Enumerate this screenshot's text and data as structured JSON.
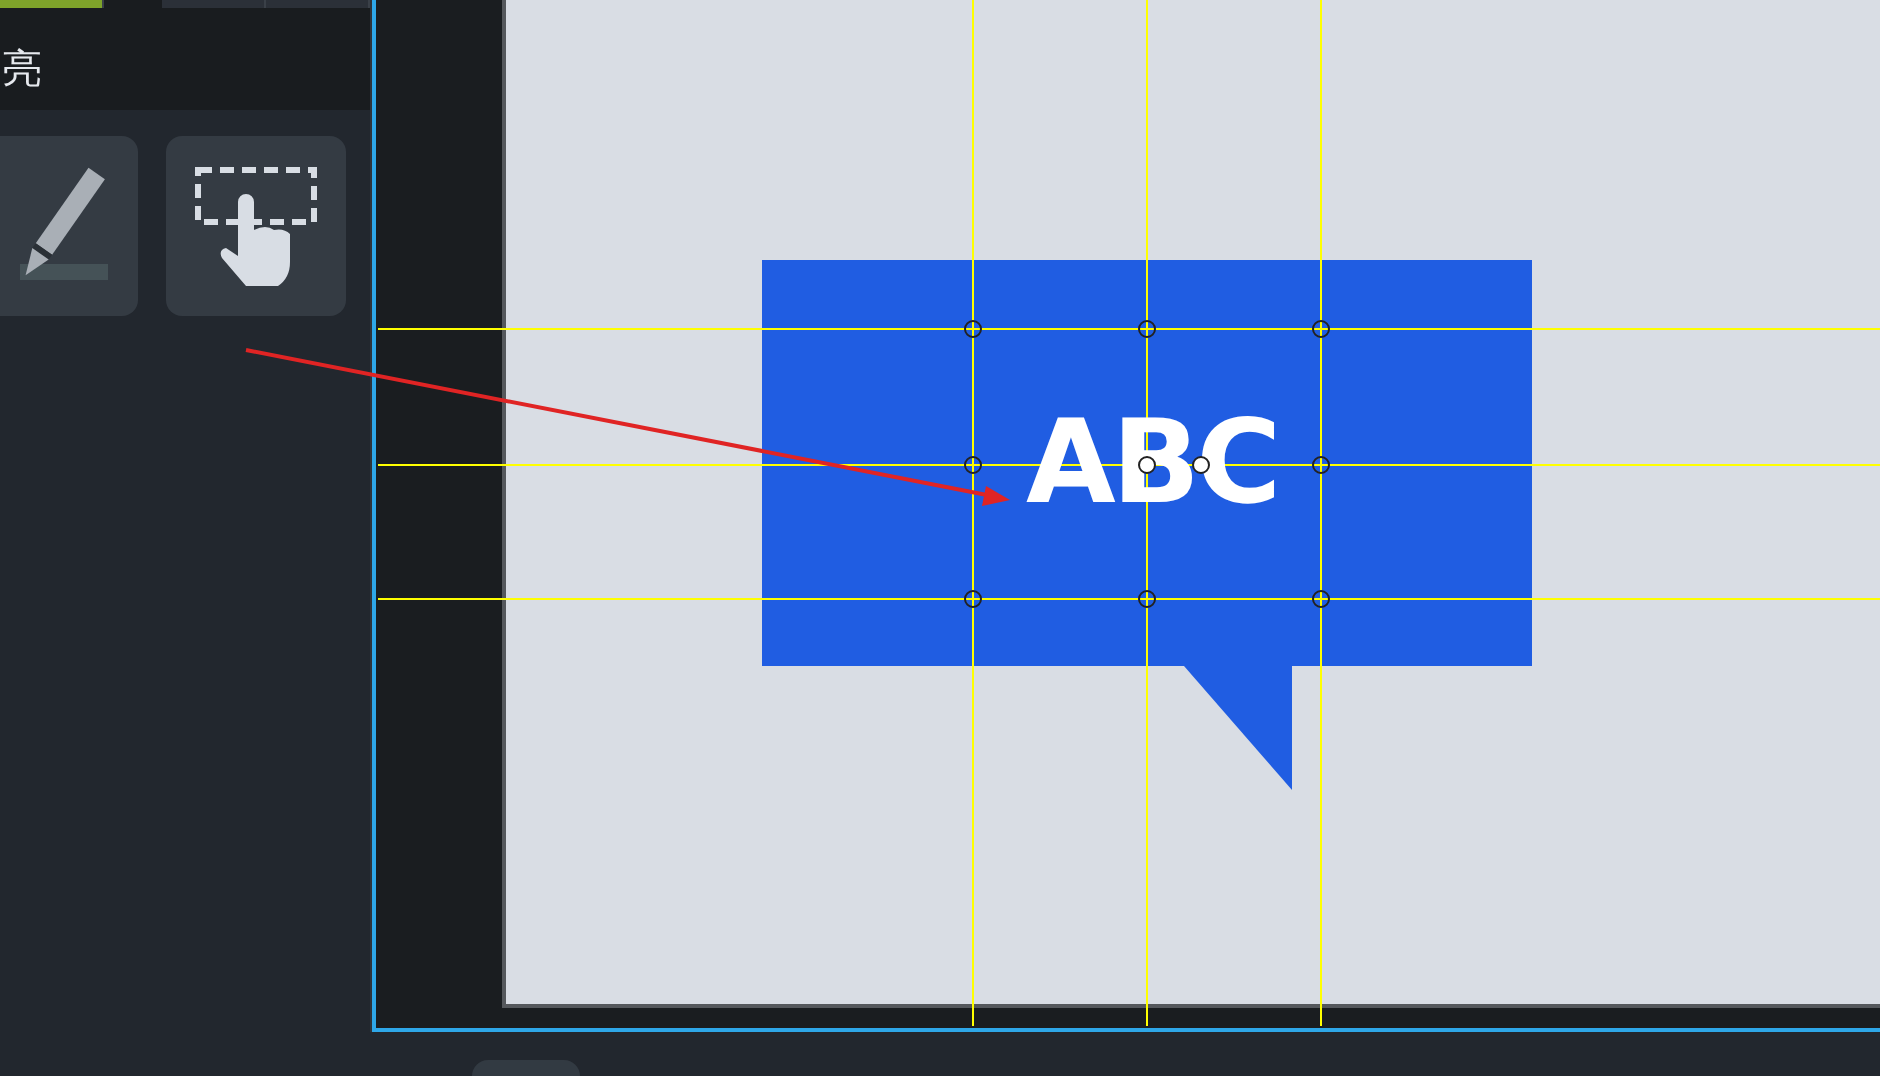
{
  "panel": {
    "tabs": [
      {
        "selected": true
      },
      {
        "selected": false
      },
      {
        "selected": false
      }
    ],
    "title": "亮",
    "tools": [
      {
        "kind": "pen"
      },
      {
        "kind": "select"
      }
    ]
  },
  "canvas": {
    "callout": {
      "text": "ABC"
    }
  }
}
